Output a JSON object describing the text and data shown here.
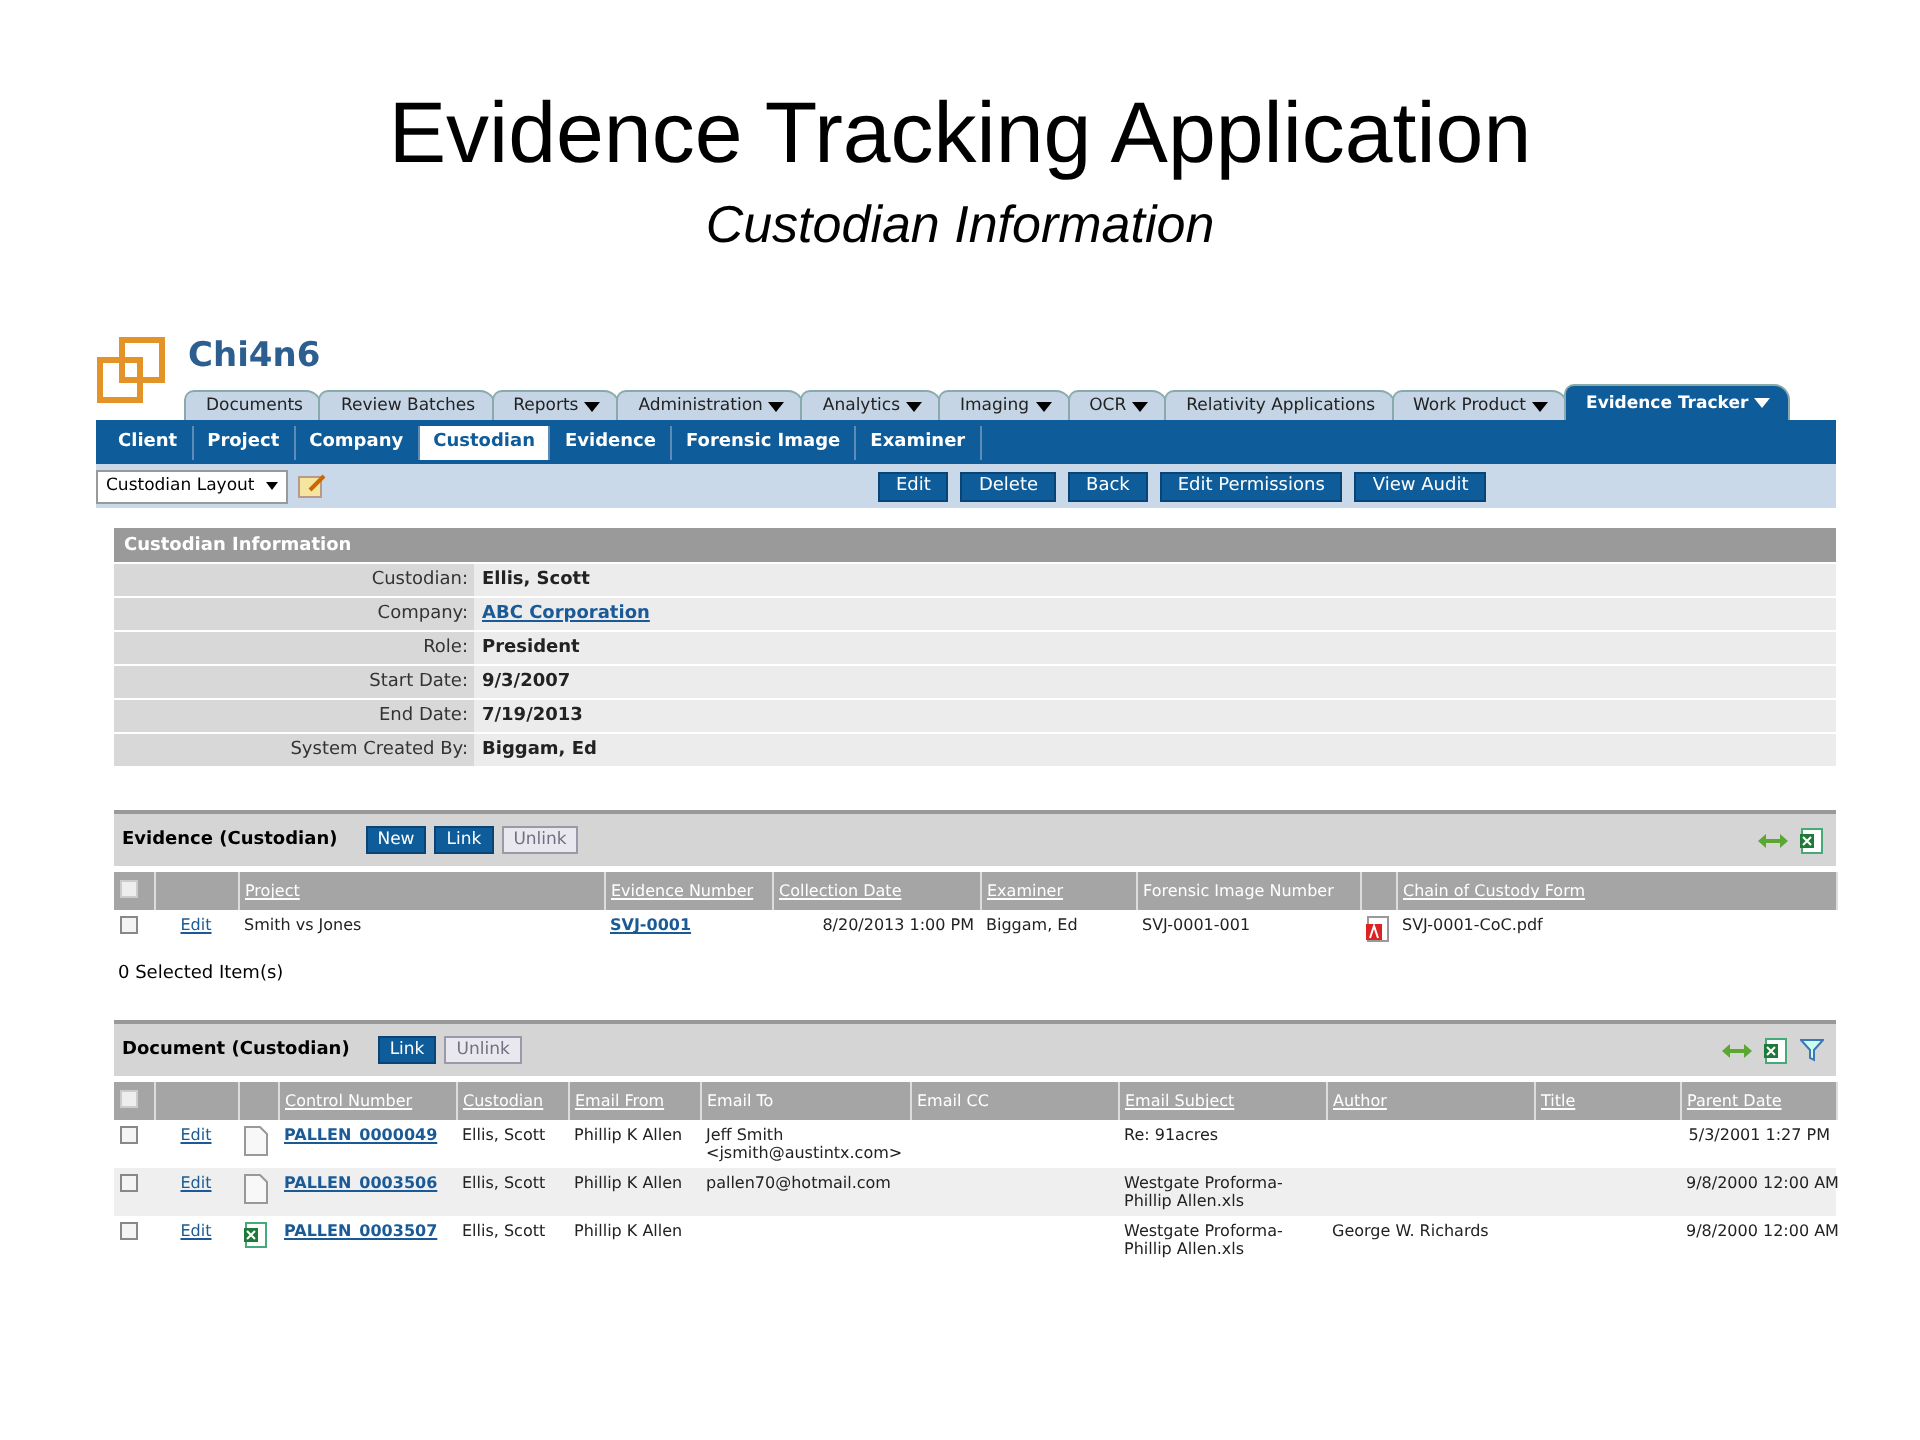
{
  "slide": {
    "title": "Evidence Tracking Application",
    "subtitle": "Custodian Information"
  },
  "app": {
    "logo_text": "Chi4n6"
  },
  "tabs": [
    {
      "label": "Documents",
      "dropdown": false,
      "selected": false
    },
    {
      "label": "Review Batches",
      "dropdown": false,
      "selected": false
    },
    {
      "label": "Reports",
      "dropdown": true,
      "selected": false
    },
    {
      "label": "Administration",
      "dropdown": true,
      "selected": false
    },
    {
      "label": "Analytics",
      "dropdown": true,
      "selected": false
    },
    {
      "label": "Imaging",
      "dropdown": true,
      "selected": false
    },
    {
      "label": "OCR",
      "dropdown": true,
      "selected": false
    },
    {
      "label": "Relativity Applications",
      "dropdown": false,
      "selected": false
    },
    {
      "label": "Work Product",
      "dropdown": true,
      "selected": false
    },
    {
      "label": "Evidence Tracker",
      "dropdown": true,
      "selected": true
    }
  ],
  "subtabs": [
    {
      "label": "Client",
      "selected": false
    },
    {
      "label": "Project",
      "selected": false
    },
    {
      "label": "Company",
      "selected": false
    },
    {
      "label": "Custodian",
      "selected": true
    },
    {
      "label": "Evidence",
      "selected": false
    },
    {
      "label": "Forensic Image",
      "selected": false
    },
    {
      "label": "Examiner",
      "selected": false
    }
  ],
  "toolbar": {
    "layout_select": "Custodian Layout",
    "buttons": [
      "Edit",
      "Delete",
      "Back",
      "Edit Permissions",
      "View Audit"
    ]
  },
  "custodian_info": {
    "title": "Custodian Information",
    "fields": [
      {
        "label": "Custodian:",
        "value": "Ellis, Scott",
        "link": false
      },
      {
        "label": "Company:",
        "value": "ABC Corporation",
        "link": true
      },
      {
        "label": "Role:",
        "value": "President",
        "link": false
      },
      {
        "label": "Start Date:",
        "value": "9/3/2007",
        "link": false
      },
      {
        "label": "End Date:",
        "value": "7/19/2013",
        "link": false
      },
      {
        "label": "System Created By:",
        "value": "Biggam, Ed",
        "link": false
      }
    ]
  },
  "evidence": {
    "title": "Evidence (Custodian)",
    "buttons": [
      {
        "label": "New",
        "disabled": false
      },
      {
        "label": "Link",
        "disabled": false
      },
      {
        "label": "Unlink",
        "disabled": true
      }
    ],
    "columns": [
      {
        "kind": "check",
        "checked": false
      },
      {
        "kind": "edit"
      },
      {
        "kind": "text",
        "label": "Project",
        "sortable": true
      },
      {
        "kind": "link",
        "label": "Evidence Number",
        "sortable": true
      },
      {
        "kind": "date",
        "label": "Collection Date",
        "sortable": true
      },
      {
        "kind": "text",
        "label": "Examiner",
        "sortable": true
      },
      {
        "kind": "text",
        "label": "Forensic Image Number",
        "sortable": false
      },
      {
        "kind": "icon"
      },
      {
        "kind": "text",
        "label": "Chain of Custody Form",
        "sortable": true
      }
    ],
    "rows": [
      {
        "checked": false,
        "kind": "pdf",
        "cells": [
          "",
          "Edit",
          "Smith vs Jones",
          "SVJ-0001",
          "8/20/2013 1:00 PM",
          "Biggam, Ed",
          "SVJ-0001-001",
          "",
          "SVJ-0001-CoC.pdf"
        ]
      }
    ],
    "selected_count": "0  Selected Item(s)"
  },
  "documents": {
    "title": "Document (Custodian)",
    "buttons": [
      {
        "label": "Link",
        "disabled": false
      },
      {
        "label": "Unlink",
        "disabled": true
      }
    ],
    "columns": [
      {
        "kind": "check",
        "checked": false
      },
      {
        "kind": "edit"
      },
      {
        "kind": "icon"
      },
      {
        "kind": "link",
        "label": "Control Number",
        "sortable": true
      },
      {
        "kind": "text",
        "label": "Custodian",
        "sortable": true
      },
      {
        "kind": "text",
        "label": "Email From",
        "sortable": true
      },
      {
        "kind": "text",
        "label": "Email To",
        "sortable": false
      },
      {
        "kind": "text",
        "label": "Email CC",
        "sortable": false
      },
      {
        "kind": "text",
        "label": "Email Subject",
        "sortable": true
      },
      {
        "kind": "text",
        "label": "Author",
        "sortable": true
      },
      {
        "kind": "text",
        "label": "Title",
        "sortable": true
      },
      {
        "kind": "date",
        "label": "Parent Date",
        "sortable": true
      }
    ],
    "rows": [
      {
        "checked": false,
        "kind": "document",
        "cells": [
          "",
          "Edit",
          "",
          "PALLEN_0000049",
          "Ellis, Scott",
          "Phillip K Allen",
          "Jeff Smith <jsmith@austintx.com>",
          "",
          "Re: 91acres",
          "",
          "",
          "5/3/2001 1:27 PM"
        ]
      },
      {
        "checked": false,
        "kind": "document",
        "cells": [
          "",
          "Edit",
          "",
          "PALLEN_0003506",
          "Ellis, Scott",
          "Phillip K Allen",
          "pallen70@hotmail.com",
          "",
          "Westgate Proforma-Phillip Allen.xls",
          "",
          "",
          "9/8/2000 12:00 AM"
        ]
      },
      {
        "checked": false,
        "kind": "spreadsheet",
        "cells": [
          "",
          "Edit",
          "",
          "PALLEN_0003507",
          "Ellis, Scott",
          "Phillip K Allen",
          "",
          "",
          "Westgate Proforma-Phillip Allen.xls",
          "George W. Richards",
          "",
          "9/8/2000 12:00 AM"
        ]
      }
    ]
  }
}
